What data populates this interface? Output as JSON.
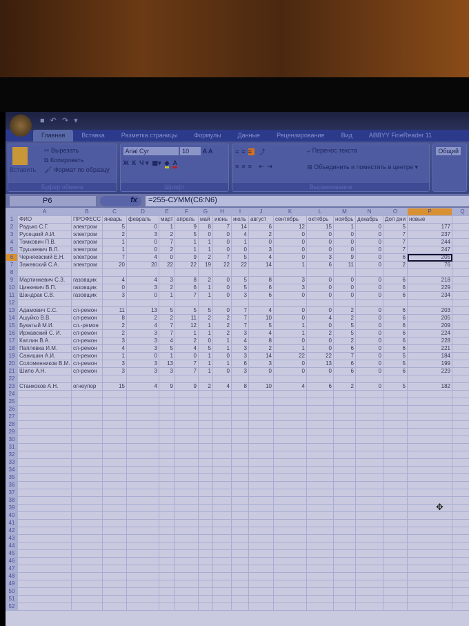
{
  "tabs": [
    "Главная",
    "Вставка",
    "Разметка страницы",
    "Формулы",
    "Данные",
    "Рецензирование",
    "Вид",
    "ABBYY FineReader 11"
  ],
  "ribbon": {
    "paste": "Вставить",
    "cut": "Вырезать",
    "copy": "Копировать",
    "format_painter": "Формат по образцу",
    "clipboard_group": "Буфер обмена",
    "font_name": "Arial Cyr",
    "font_size": "10",
    "font_group": "Шрифт",
    "wrap_text": "Перенос текста",
    "merge_center": "Объединить и поместить в центре",
    "align_group": "Выравнивание",
    "number_format": "Общий"
  },
  "formula_bar": {
    "name_box": "P6",
    "fx": "fx",
    "formula": "=255-СУММ(C6:N6)"
  },
  "columns": [
    "A",
    "B",
    "C",
    "D",
    "E",
    "F",
    "G",
    "H",
    "I",
    "J",
    "K",
    "L",
    "M",
    "N",
    "O",
    "P",
    "Q"
  ],
  "selected_cell": "P6",
  "header_row": [
    "ФИО",
    "ПРОФЕСС",
    "январь",
    "февраль",
    "март",
    "апрель",
    "май",
    "июнь",
    "июль",
    "август",
    "сентябрь",
    "октябрь",
    "ноябрь",
    "декабрь",
    "Доп дни",
    "новые"
  ],
  "rows": {
    "2": [
      "Радько С.Г.",
      "электром",
      5,
      0,
      1,
      9,
      8,
      7,
      14,
      6,
      12,
      15,
      1,
      0,
      5,
      177
    ],
    "3": [
      "Русецкий А.И.",
      "электром",
      2,
      3,
      2,
      5,
      0,
      0,
      4,
      2,
      0,
      0,
      0,
      0,
      7,
      237
    ],
    "4": [
      "Томкович П.В.",
      "электром",
      1,
      0,
      7,
      1,
      1,
      0,
      1,
      0,
      0,
      0,
      0,
      0,
      7,
      244
    ],
    "5": [
      "Трушкевич В.Л.",
      "электром",
      1,
      0,
      2,
      1,
      1,
      0,
      0,
      3,
      0,
      0,
      0,
      0,
      7,
      247
    ],
    "6": [
      "Черняевский Е.Н.",
      "электром",
      7,
      4,
      0,
      9,
      2,
      7,
      5,
      4,
      0,
      3,
      9,
      0,
      6,
      205
    ],
    "7": [
      "Зажевский С.А.",
      "электром",
      20,
      20,
      22,
      22,
      19,
      22,
      22,
      14,
      1,
      6,
      11,
      0,
      2,
      76
    ],
    "9": [
      "Мартинкевич С.З.",
      "газовщик",
      4,
      4,
      3,
      8,
      2,
      0,
      5,
      8,
      3,
      0,
      0,
      0,
      6,
      218
    ],
    "10": [
      "Цинкевич В.П.",
      "газовщик",
      0,
      3,
      2,
      6,
      1,
      0,
      5,
      6,
      3,
      0,
      0,
      0,
      6,
      229
    ],
    "11": [
      "Шандрак С.В.",
      "газовщик",
      3,
      0,
      1,
      7,
      1,
      0,
      3,
      6,
      0,
      0,
      0,
      0,
      6,
      234
    ],
    "13": [
      "Адамович С.С.",
      "сл-ремон",
      11,
      13,
      5,
      5,
      5,
      0,
      7,
      4,
      0,
      0,
      2,
      0,
      6,
      203
    ],
    "14": [
      "Ашуйко В.В.",
      "сл-ремон",
      8,
      2,
      2,
      11,
      2,
      2,
      7,
      10,
      0,
      4,
      2,
      0,
      6,
      205
    ],
    "15": [
      "Букатый М.И.",
      "сл.-ремон",
      2,
      4,
      7,
      12,
      1,
      2,
      7,
      5,
      1,
      0,
      5,
      0,
      6,
      209
    ],
    "16": [
      "Иржавский С. И.",
      "сл-ремон",
      2,
      3,
      7,
      1,
      1,
      2,
      3,
      4,
      1,
      2,
      5,
      0,
      6,
      224
    ],
    "17": [
      "Каплин В.А.",
      "сл-ремон",
      3,
      3,
      4,
      2,
      0,
      1,
      4,
      8,
      0,
      0,
      2,
      0,
      6,
      228
    ],
    "18": [
      "Паплевка И.М.",
      "сл-ремон",
      4,
      3,
      5,
      4,
      5,
      1,
      3,
      2,
      1,
      0,
      6,
      0,
      6,
      221
    ],
    "19": [
      "Санишин А.И.",
      "сл-ремон",
      1,
      0,
      1,
      0,
      1,
      0,
      3,
      14,
      22,
      22,
      7,
      0,
      5,
      184
    ],
    "20": [
      "Соломенников В.М.",
      "сл-ремон",
      3,
      3,
      13,
      7,
      1,
      1,
      6,
      3,
      0,
      13,
      6,
      0,
      5,
      199
    ],
    "21": [
      "Шило А.Н.",
      "сл-ремон",
      3,
      3,
      3,
      7,
      1,
      0,
      3,
      0,
      0,
      0,
      6,
      0,
      6,
      229
    ],
    "23": [
      "Станкоков А.Н.",
      "огнеупор",
      15,
      4,
      9,
      9,
      2,
      4,
      8,
      10,
      4,
      6,
      2,
      0,
      5,
      182
    ]
  },
  "row_count": 52
}
